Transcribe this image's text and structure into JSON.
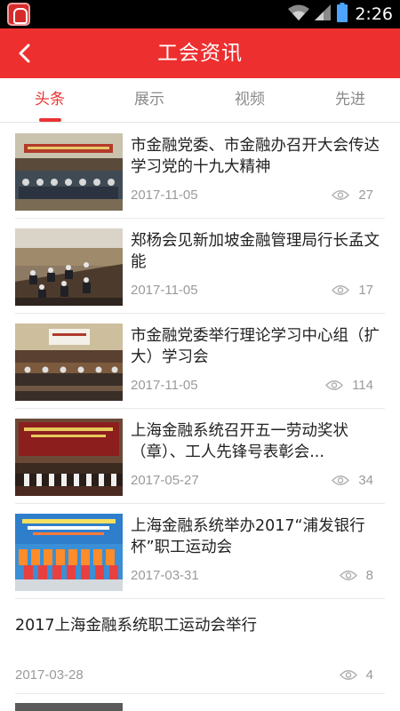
{
  "status_bar": {
    "time": "2:26",
    "icons": [
      "app-icon",
      "wifi-icon",
      "signal-icon",
      "battery-icon"
    ]
  },
  "header": {
    "title": "工会资讯",
    "back_icon": "chevron-left-icon"
  },
  "tabs": [
    {
      "label": "头条",
      "active": true
    },
    {
      "label": "展示",
      "active": false
    },
    {
      "label": "视频",
      "active": false
    },
    {
      "label": "先进",
      "active": false
    }
  ],
  "news": [
    {
      "title": "市金融党委、市金融办召开大会传达学习党的十九大精神",
      "date": "2017-11-05",
      "views": "27",
      "has_image": true
    },
    {
      "title": "郑杨会见新加坡金融管理局行长孟文能",
      "date": "2017-11-05",
      "views": "17",
      "has_image": true
    },
    {
      "title": "市金融党委举行理论学习中心组（扩大）学习会",
      "date": "2017-11-05",
      "views": "114",
      "has_image": true
    },
    {
      "title": "上海金融系统召开五一劳动奖状（章）、工人先锋号表彰会...",
      "date": "2017-05-27",
      "views": "34",
      "has_image": true
    },
    {
      "title": "上海金融系统举办2017“浦发银行杯”职工运动会",
      "date": "2017-03-31",
      "views": "8",
      "has_image": true
    },
    {
      "title": "2017上海金融系统职工运动会举行",
      "date": "2017-03-28",
      "views": "4",
      "has_image": false
    }
  ],
  "colors": {
    "accent": "#ed2f2f",
    "tab_active": "#ea3232",
    "text": "#222222",
    "meta": "#9a9a9a"
  }
}
